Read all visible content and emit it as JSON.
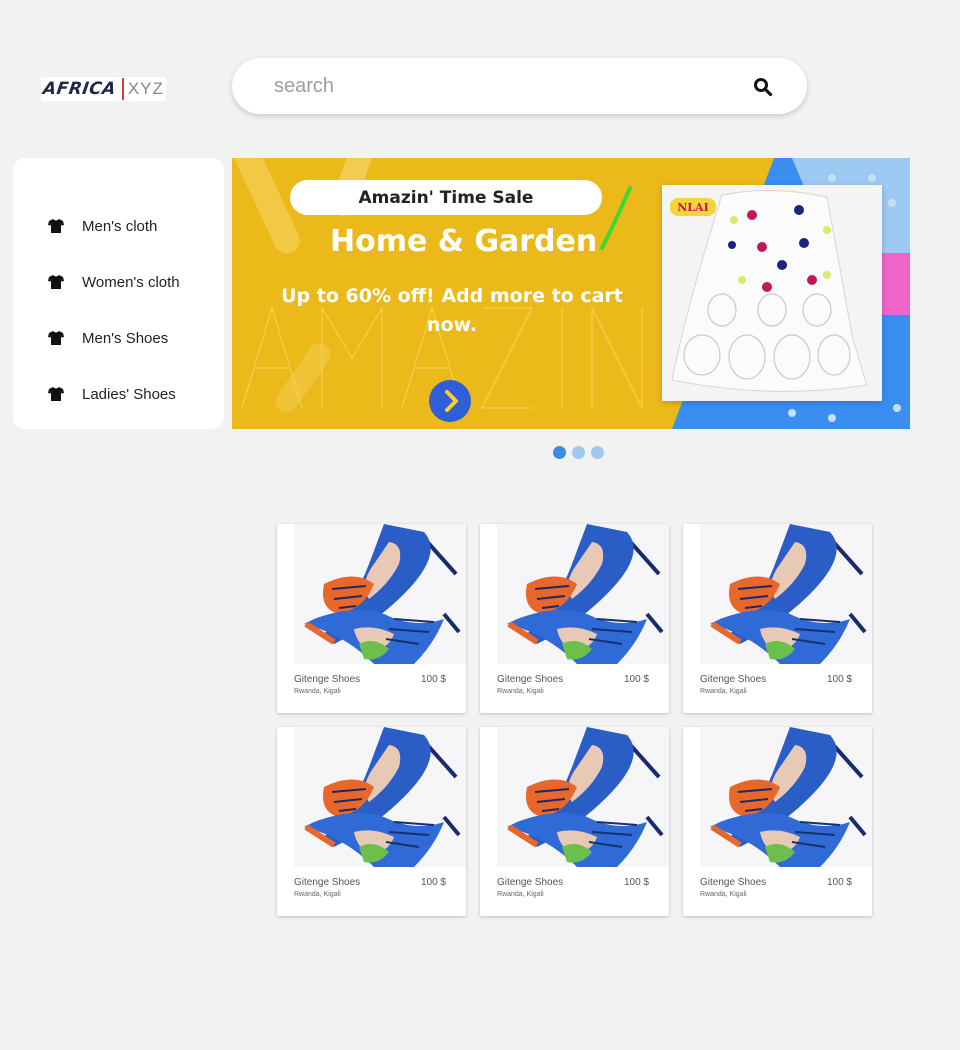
{
  "logo": {
    "brand": "AFRICA",
    "suffix": "XYZ"
  },
  "search": {
    "placeholder": "search"
  },
  "sidebar": {
    "items": [
      {
        "label": "Men's cloth",
        "icon": "shirt-icon"
      },
      {
        "label": "Women's cloth",
        "icon": "shirt-icon"
      },
      {
        "label": "Men's Shoes",
        "icon": "shirt-icon"
      },
      {
        "label": "Ladies' Shoes",
        "icon": "shirt-icon"
      }
    ]
  },
  "banner": {
    "pill": "Amazin' Time Sale",
    "title": "Home & Garden",
    "subtitle": "Up to 60% off! Add more to cart now.",
    "badge": "NLAI",
    "colors": {
      "background": "#ecb91a",
      "arrow": "#2f5fd7",
      "accent_blue": "#3a8ef0",
      "accent_pink": "#f063c8"
    }
  },
  "carousel": {
    "count": 3,
    "active": 0
  },
  "products": [
    {
      "name": "Gitenge Shoes",
      "price": "100 $",
      "location": "Rwanda, Kigali"
    },
    {
      "name": "Gitenge Shoes",
      "price": "100 $",
      "location": "Rwanda, Kigali"
    },
    {
      "name": "Gitenge Shoes",
      "price": "100 $",
      "location": "Rwanda, Kigali"
    },
    {
      "name": "Gitenge Shoes",
      "price": "100 $",
      "location": "Rwanda, Kigali"
    },
    {
      "name": "Gitenge Shoes",
      "price": "100 $",
      "location": "Rwanda, Kigali"
    },
    {
      "name": "Gitenge Shoes",
      "price": "100 $",
      "location": "Rwanda, Kigali"
    }
  ]
}
